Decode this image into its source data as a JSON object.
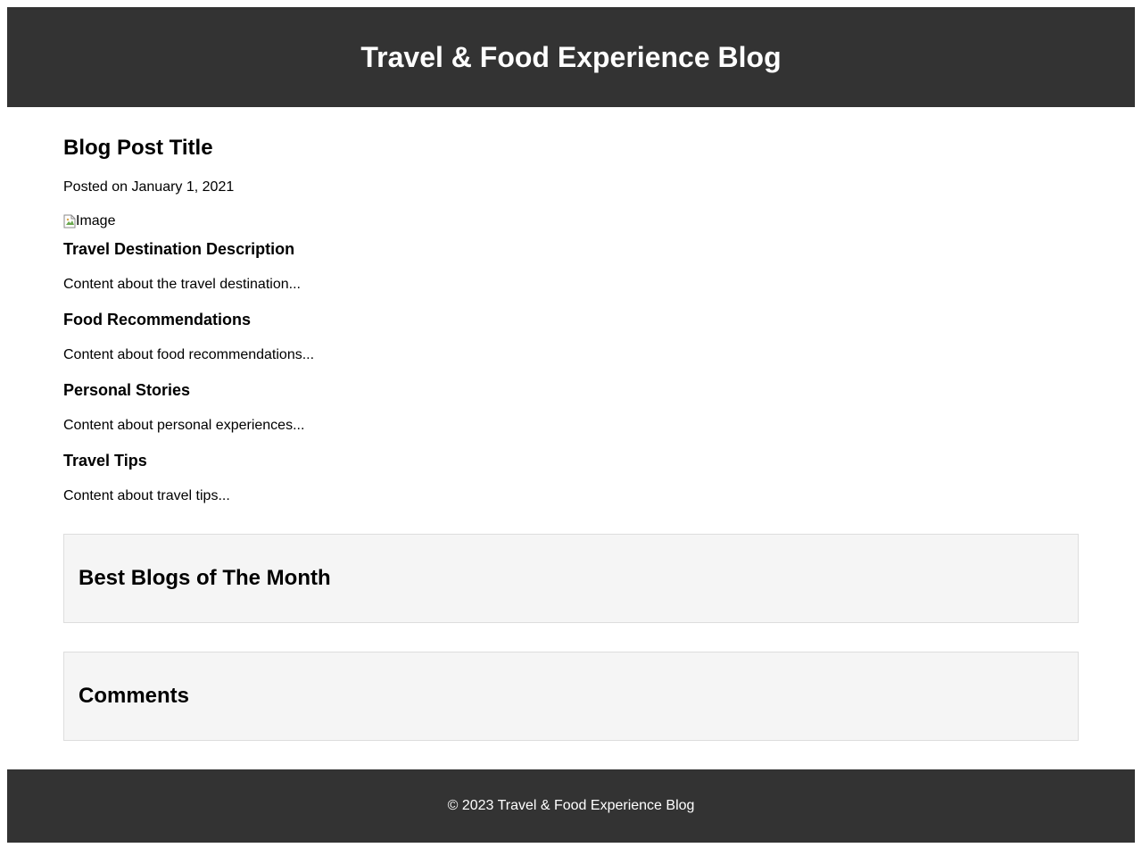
{
  "header": {
    "title": "Travel & Food Experience Blog"
  },
  "post": {
    "title": "Blog Post Title",
    "date": "Posted on January 1, 2021",
    "image_alt": "Image",
    "sections": [
      {
        "heading": "Travel Destination Description",
        "text": "Content about the travel destination..."
      },
      {
        "heading": "Food Recommendations",
        "text": "Content about food recommendations..."
      },
      {
        "heading": "Personal Stories",
        "text": "Content about personal experiences..."
      },
      {
        "heading": "Travel Tips",
        "text": "Content about travel tips..."
      }
    ]
  },
  "best_blogs": {
    "title": "Best Blogs of The Month"
  },
  "comments": {
    "title": "Comments"
  },
  "footer": {
    "text": "© 2023 Travel & Food Experience Blog"
  },
  "colors": {
    "header_bg": "#333333",
    "footer_bg": "#333333",
    "panel_bg": "#f5f5f5",
    "panel_border": "#dddddd"
  }
}
